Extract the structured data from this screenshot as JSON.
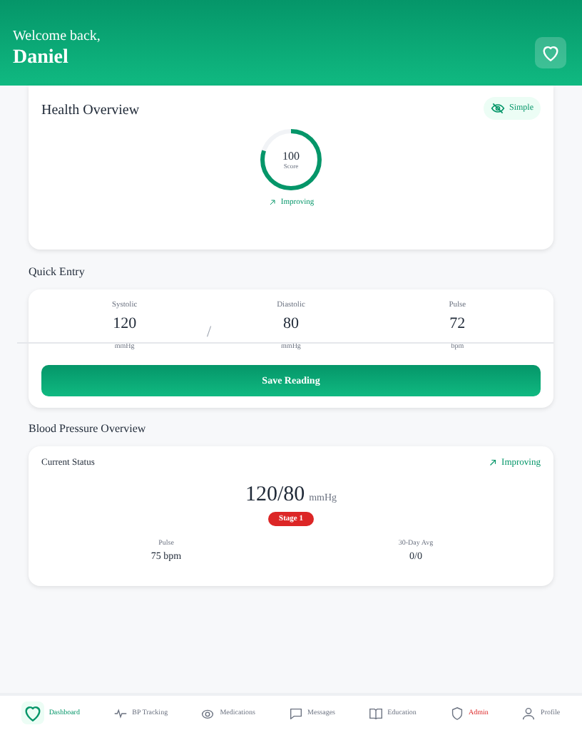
{
  "header": {
    "greeting": "Welcome back,",
    "name": "Daniel"
  },
  "health_overview": {
    "title": "Health Overview",
    "toggle": {
      "label": "Simple",
      "on": true
    },
    "score": {
      "value": "100",
      "label": "Score",
      "level": 0.8
    },
    "trend": "Improving"
  },
  "quick_entry": {
    "title": "Quick Entry",
    "fields": [
      {
        "label": "Systolic",
        "value": "120",
        "unit": "mmHg"
      },
      {
        "label": "Diastolic",
        "value": "80",
        "unit": "mmHg"
      },
      {
        "label": "Pulse",
        "value": "72",
        "unit": "bpm"
      }
    ],
    "separator": "/",
    "button": "Save Reading"
  },
  "bp_overview": {
    "title": "Blood Pressure Overview",
    "status_title": "Current Status",
    "trend": "Improving",
    "reading": "120/80",
    "unit": "mmHg",
    "stage": "Stage 1",
    "stats": [
      {
        "label": "Pulse",
        "value": "75 bpm"
      },
      {
        "label": "30-Day Avg",
        "value": "0/0"
      }
    ]
  },
  "nav": [
    {
      "label": "Dashboard",
      "selected": true,
      "kind": "normal"
    },
    {
      "label": "BP Tracking",
      "selected": false,
      "kind": "normal"
    },
    {
      "label": "Medications",
      "selected": false,
      "kind": "normal"
    },
    {
      "label": "Messages",
      "selected": false,
      "kind": "normal"
    },
    {
      "label": "Education",
      "selected": false,
      "kind": "normal"
    },
    {
      "label": "Admin",
      "selected": false,
      "kind": "admin"
    },
    {
      "label": "Profile",
      "selected": false,
      "kind": "normal"
    }
  ]
}
